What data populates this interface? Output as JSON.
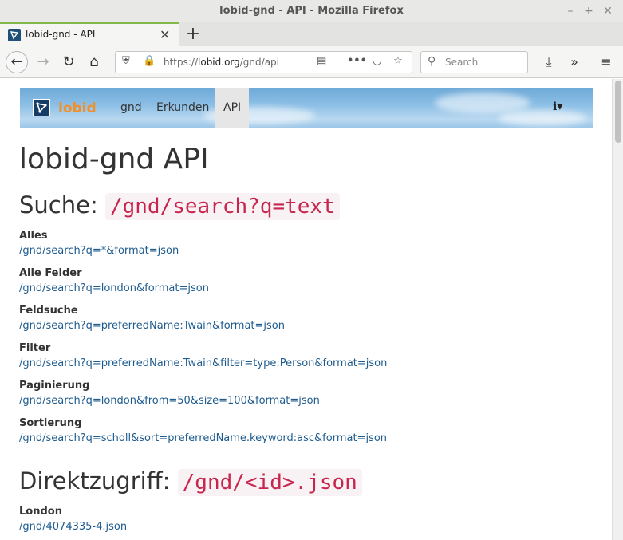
{
  "window": {
    "title": "lobid-gnd - API - Mozilla Firefox"
  },
  "tab": {
    "title": "lobid-gnd - API"
  },
  "urlbar": {
    "prefix": "https://",
    "host": "lobid.org",
    "path": "/gnd/api"
  },
  "search": {
    "placeholder": "Search"
  },
  "site": {
    "brand": "lobid",
    "nav": [
      {
        "label": "gnd"
      },
      {
        "label": "Erkunden"
      },
      {
        "label": "API"
      }
    ]
  },
  "page": {
    "title": "lobid-gnd API",
    "search_section": {
      "heading": "Suche:",
      "code": "/gnd/search?q=text",
      "items": [
        {
          "label": "Alles",
          "link": "/gnd/search?q=*&format=json"
        },
        {
          "label": "Alle Felder",
          "link": "/gnd/search?q=london&format=json"
        },
        {
          "label": "Feldsuche",
          "link": "/gnd/search?q=preferredName:Twain&format=json"
        },
        {
          "label": "Filter",
          "link": "/gnd/search?q=preferredName:Twain&filter=type:Person&format=json"
        },
        {
          "label": "Paginierung",
          "link": "/gnd/search?q=london&from=50&size=100&format=json"
        },
        {
          "label": "Sortierung",
          "link": "/gnd/search?q=scholl&sort=preferredName.keyword:asc&format=json"
        }
      ]
    },
    "direct_section": {
      "heading": "Direktzugriff:",
      "code": "/gnd/<id>.json",
      "items": [
        {
          "label": "London",
          "link": "/gnd/4074335-4.json"
        }
      ]
    }
  }
}
